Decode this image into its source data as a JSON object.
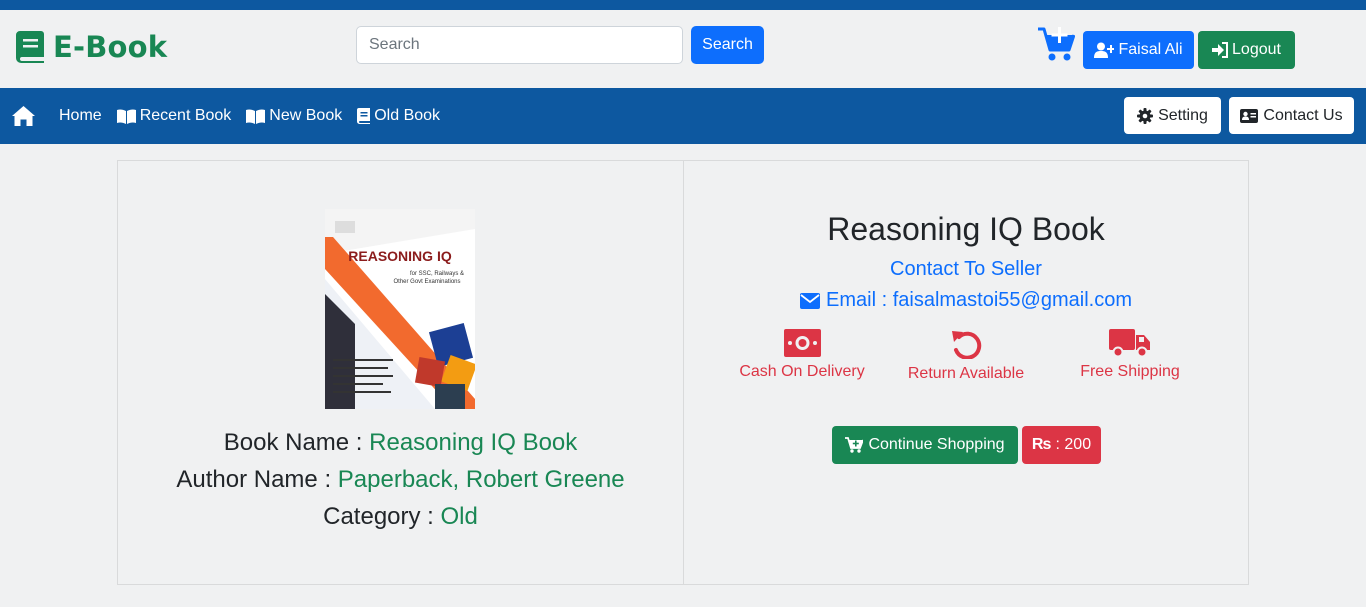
{
  "brand": {
    "name": "E-Book"
  },
  "search": {
    "placeholder": "Search",
    "button_label": "Search"
  },
  "user": {
    "name": "Faisal Ali",
    "logout_label": "Logout"
  },
  "nav": {
    "items": [
      {
        "label": "Home",
        "icon": "home-icon"
      },
      {
        "label": "Recent Book",
        "icon": "book-open-icon"
      },
      {
        "label": "New Book",
        "icon": "book-open-icon"
      },
      {
        "label": "Old Book",
        "icon": "book-icon"
      }
    ],
    "setting_label": "Setting",
    "contact_label": "Contact Us"
  },
  "book": {
    "cover_title": "REASONING IQ",
    "cover_subtitle_1": "for SSC, Railways &",
    "cover_subtitle_2": "Other Govt Examinations",
    "name_label": "Book Name :",
    "name": "Reasoning IQ Book",
    "author_label": "Author Name :",
    "author": "Paperback, Robert Greene",
    "category_label": "Category :",
    "category": "Old"
  },
  "detail": {
    "title": "Reasoning IQ Book",
    "contact_seller": "Contact To Seller",
    "email": "Email : faisalmastoi55@gmail.com",
    "features": [
      {
        "label": "Cash On Delivery",
        "icon": "money-bill-icon"
      },
      {
        "label": "Return Available",
        "icon": "undo-icon"
      },
      {
        "label": "Free Shipping",
        "icon": "truck-icon"
      }
    ],
    "continue_label": "Continue Shopping",
    "price_currency": "₨",
    "price": ": 200"
  },
  "colors": {
    "primary": "#0d6efd",
    "success": "#198754",
    "danger": "#dc3545",
    "navbar": "#0d58a0",
    "background": "#f0f1f2"
  }
}
